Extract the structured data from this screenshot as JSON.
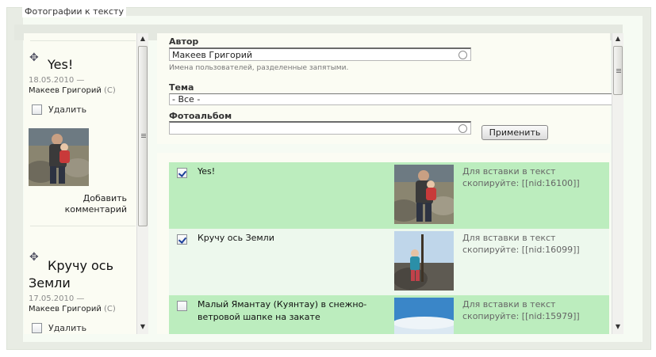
{
  "panel": {
    "legend": "Фотографии к тексту"
  },
  "left_items": [
    {
      "title": "Yes!",
      "date": "18.05.2010 —",
      "author": "Макеев Григорий",
      "author_mark": "(С)",
      "delete_label": "Удалить",
      "add_comment": "Добавить комментарий"
    },
    {
      "title": "Кручу ось Земли",
      "date": "17.05.2010 —",
      "author": "Макеев Григорий",
      "author_mark": "(С)",
      "delete_label": "Удалить"
    }
  ],
  "filters": {
    "author_label": "Автор",
    "author_value": "Макеев Григорий",
    "author_hint": "Имена пользователей, разделенные запятыми.",
    "topic_label": "Тема",
    "topic_value": "- Все -",
    "album_label": "Фотоальбом",
    "album_value": "",
    "apply_button": "Применить"
  },
  "results": [
    {
      "checked": true,
      "title": "Yes!",
      "insert_line1": "Для вставки в текст",
      "insert_line2": "скопируйте: [[nid:16100]]"
    },
    {
      "checked": true,
      "title": "Кручу ось Земли",
      "insert_line1": "Для вставки в текст",
      "insert_line2": "скопируйте: [[nid:16099]]"
    },
    {
      "checked": false,
      "title": "Малый Ямантау (Куянтау) в снежно-ветровой шапке на закате",
      "insert_line1": "Для вставки в текст",
      "insert_line2": "скопируйте: [[nid:15979]]"
    }
  ],
  "icons": [
    "move-handle-icon",
    "autocomplete-throbber-icon",
    "scroll-up-arrow-icon",
    "scroll-down-arrow-icon",
    "checkbox-checked-icon"
  ],
  "colors": {
    "row_highlight": "#bcedbe",
    "row_alt": "#edf8ed",
    "panel_bg": "#fbfcf3"
  }
}
